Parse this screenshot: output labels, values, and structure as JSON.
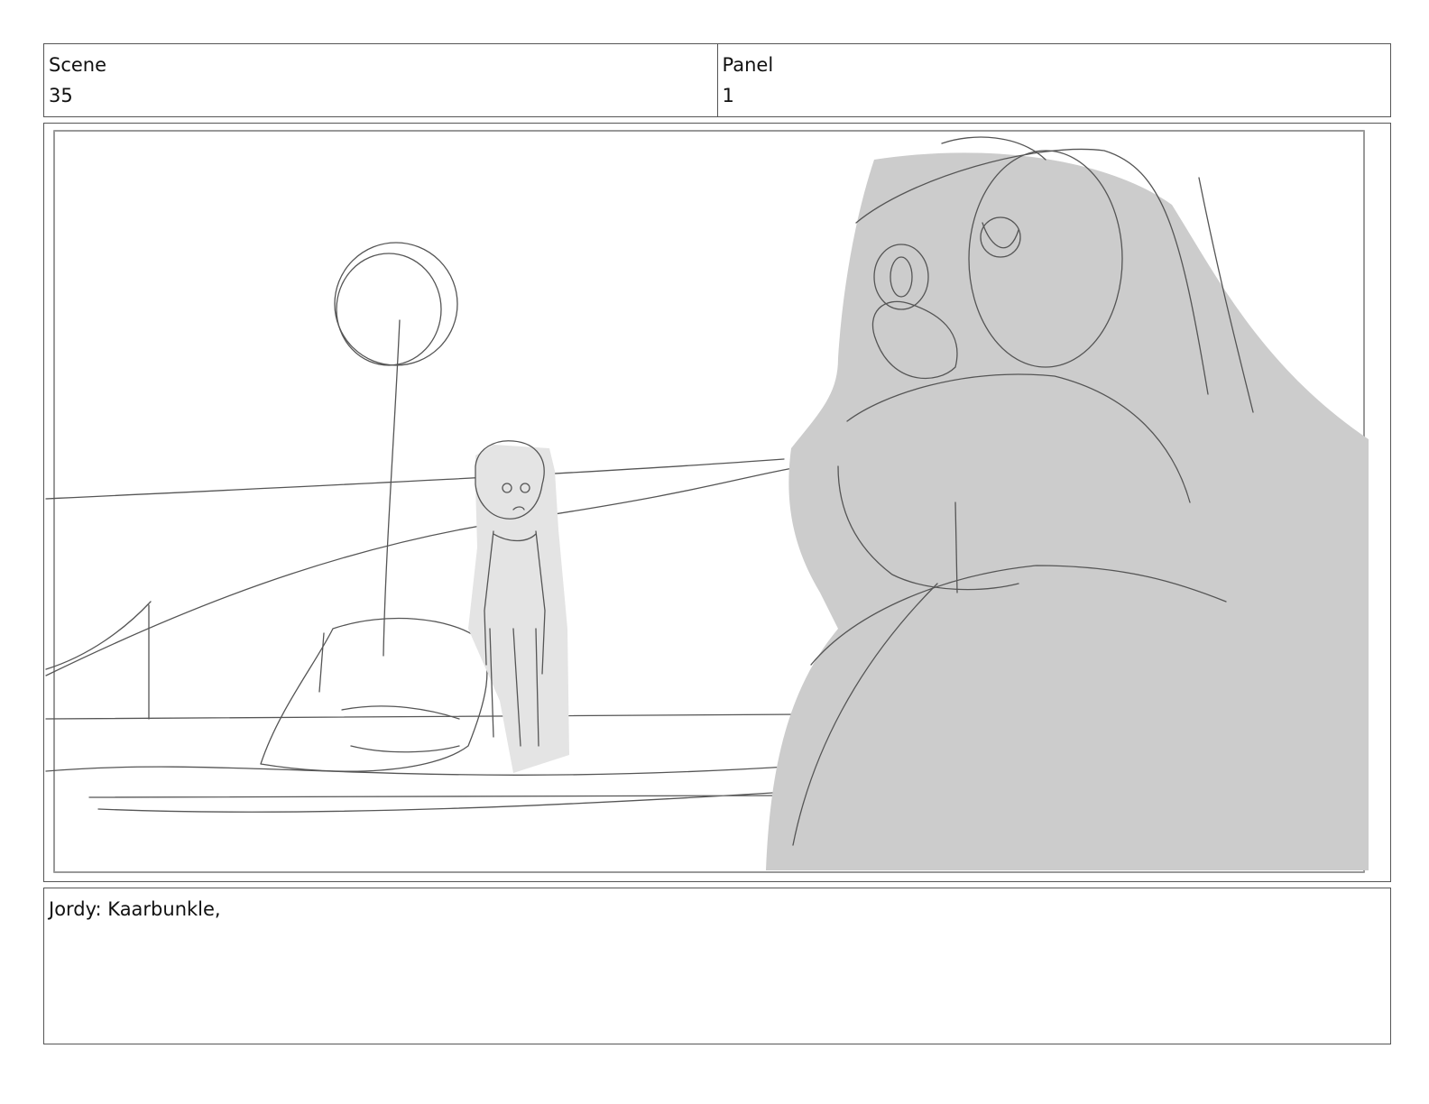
{
  "scene": {
    "label": "Scene",
    "value": "35"
  },
  "panel": {
    "label": "Panel",
    "value": "1"
  },
  "notes": {
    "dialogue": "Jordy: Kaarbunkle,"
  },
  "colors": {
    "sketch_line": "#555555",
    "tone_fill": "#cccccc",
    "tone_light": "#e4e4e4"
  }
}
